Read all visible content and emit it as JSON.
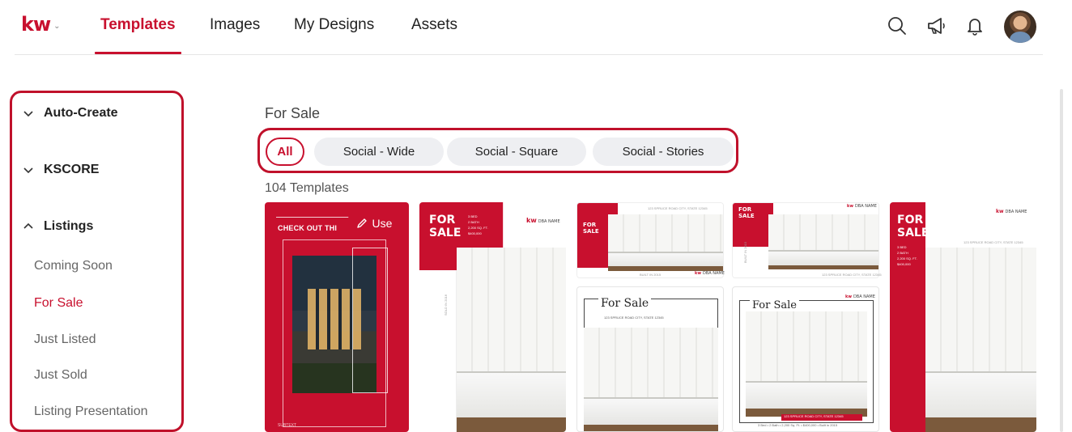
{
  "brand": {
    "logo": "kw",
    "accent": "#c8102e"
  },
  "nav": {
    "tabs": [
      {
        "label": "Templates",
        "active": true
      },
      {
        "label": "Images"
      },
      {
        "label": "My Designs"
      },
      {
        "label": "Assets"
      }
    ],
    "icons": [
      "search-icon",
      "megaphone-icon",
      "bell-icon",
      "avatar"
    ]
  },
  "sidebar": {
    "groups": [
      {
        "label": "Auto-Create",
        "expanded": false
      },
      {
        "label": "KSCORE",
        "expanded": false
      },
      {
        "label": "Listings",
        "expanded": true
      }
    ],
    "items": [
      {
        "label": "Coming Soon"
      },
      {
        "label": "For Sale",
        "active": true
      },
      {
        "label": "Just Listed"
      },
      {
        "label": "Just Sold"
      },
      {
        "label": "Listing Presentation"
      }
    ]
  },
  "main": {
    "title": "For Sale",
    "filters": [
      {
        "label": "All",
        "active": true
      },
      {
        "label": "Social - Wide"
      },
      {
        "label": "Social - Square"
      },
      {
        "label": "Social - Stories"
      }
    ],
    "count_label": "104 Templates",
    "use_label": "Use",
    "cards": {
      "card1": {
        "headline": "CHECK OUT THI",
        "subtext": "SUBTEXT"
      },
      "card2": {
        "for": "FOR",
        "sale": "SALE",
        "detail1": "3 BED",
        "detail2": "2 BATH",
        "detail3": "2,200 SQ. FT.",
        "detail4": "$400,000",
        "kw": "kw",
        "dba": "DBA NAME",
        "side": "SOLD IN 2016"
      },
      "card3": {
        "for": "FOR",
        "sale": "SALE",
        "address": "123 SPRUCE ROAD CITY, STATE 12345",
        "footer": "BUILT IN 2015",
        "kw": "kw",
        "dba": "DBA NAME"
      },
      "card4": {
        "title": "For Sale",
        "address": "123 SPRUCE ROAD CITY, STATE 12345"
      },
      "card5": {
        "for": "FOR",
        "sale": "SALE",
        "address": "123 SPRUCE ROAD CITY, STATE 12345",
        "side": "BUILT IN 2015",
        "kw": "kw",
        "dba": "DBA NAME"
      },
      "card6": {
        "title": "For Sale",
        "kw": "kw",
        "dba": "DBA NAME",
        "banner": "123 SPRUCE ROAD CITY, STATE 12345",
        "footer": "3 Bed • 2 Bath • 2,200 Sq. Ft. • $400,000 • Built in 2015"
      },
      "card7": {
        "for": "FOR",
        "sale": "SALE",
        "address": "123 SPRUCE ROAD CITY, STATE 12345",
        "detail1": "3 BED",
        "detail2": "2 BATH",
        "detail3": "2,200 SQ. FT.",
        "detail4": "$400,000",
        "kw": "kw",
        "dba": "DBA NAME"
      }
    }
  }
}
